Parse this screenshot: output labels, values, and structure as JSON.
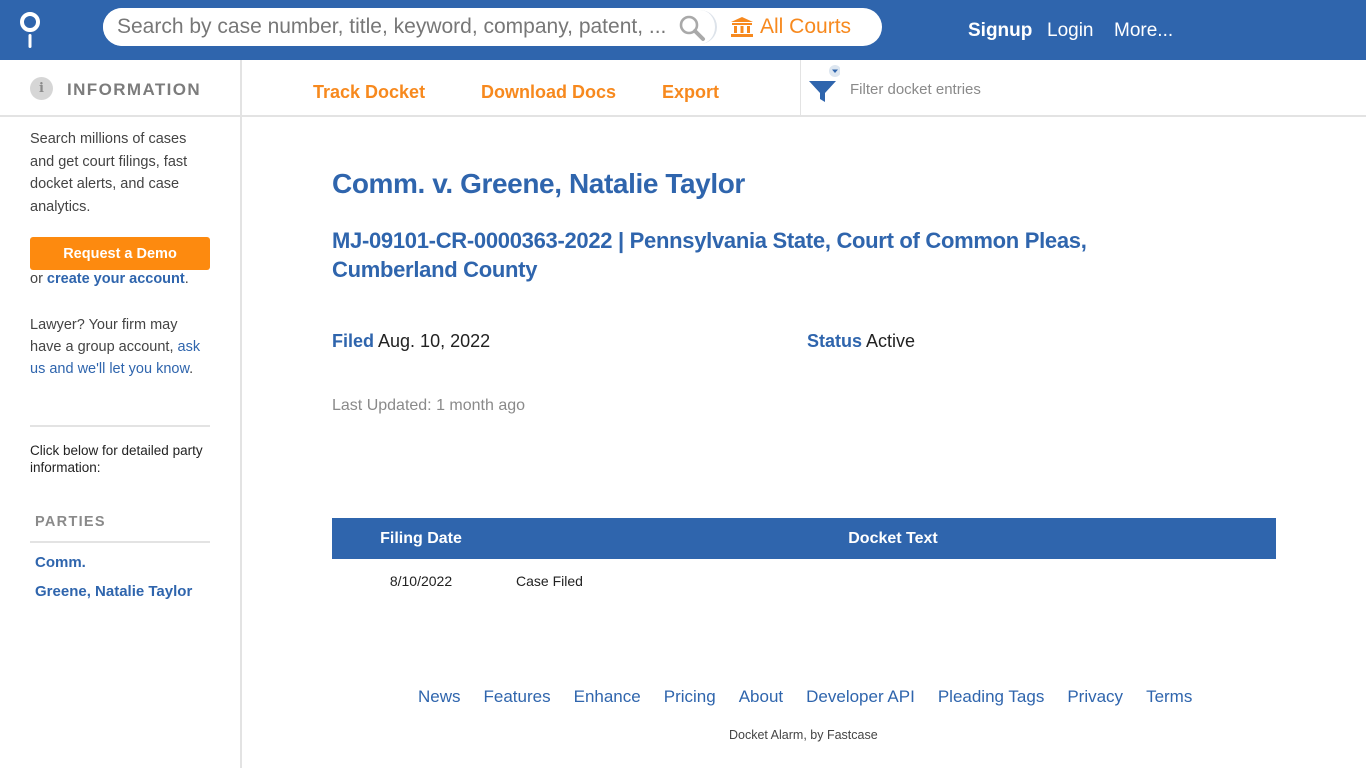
{
  "header": {
    "logo_icon": "docket-alarm-pin-icon",
    "search": {
      "placeholder": "Search by case number, title, keyword, company, patent, ...",
      "value": "",
      "icon": "search-icon"
    },
    "courts_label": "All Courts",
    "courts_icon": "courthouse-icon",
    "nav": {
      "signup": "Signup",
      "login": "Login",
      "more": "More..."
    }
  },
  "toolbar": {
    "info_icon": "info-icon",
    "info_label": "INFORMATION",
    "actions": {
      "track": "Track Docket",
      "download": "Download Docs",
      "export": "Export"
    },
    "filter": {
      "icon": "filter-icon",
      "placeholder": "Filter docket entries",
      "value": ""
    }
  },
  "sidebar": {
    "intro": "Search millions of cases and get court filings, fast docket alerts, and case analytics.",
    "demo_button": "Request a Demo",
    "or_text": "or ",
    "create_account": "create your account",
    "period": ".",
    "lawyer_text": "Lawyer? Your firm may have a group account, ",
    "lawyer_link": "ask us and we'll let you know",
    "click_below": "Click below for detailed party information:",
    "parties_label": "PARTIES",
    "parties": [
      "Comm.",
      "Greene, Natalie Taylor"
    ]
  },
  "case": {
    "title": "Comm. v. Greene, Natalie Taylor",
    "subtitle": "MJ-09101-CR-0000363-2022 | Pennsylvania State, Court of Common Pleas, Cumberland County",
    "filed_label": "Filed",
    "filed_value": "Aug. 10, 2022",
    "status_label": "Status",
    "status_value": "Active",
    "last_updated": "Last Updated: 1 month ago"
  },
  "docket": {
    "columns": [
      "Filing Date",
      "Docket Text"
    ],
    "rows": [
      {
        "date": "8/10/2022",
        "text": "Case Filed"
      }
    ]
  },
  "footer": {
    "links": [
      "News",
      "Features",
      "Enhance",
      "Pricing",
      "About",
      "Developer API",
      "Pleading Tags",
      "Privacy",
      "Terms"
    ],
    "copyright": "Docket Alarm, by Fastcase"
  },
  "colors": {
    "brand_blue": "#2f65ad",
    "accent_orange": "#f7891e",
    "demo_orange": "#fd8a0f"
  }
}
